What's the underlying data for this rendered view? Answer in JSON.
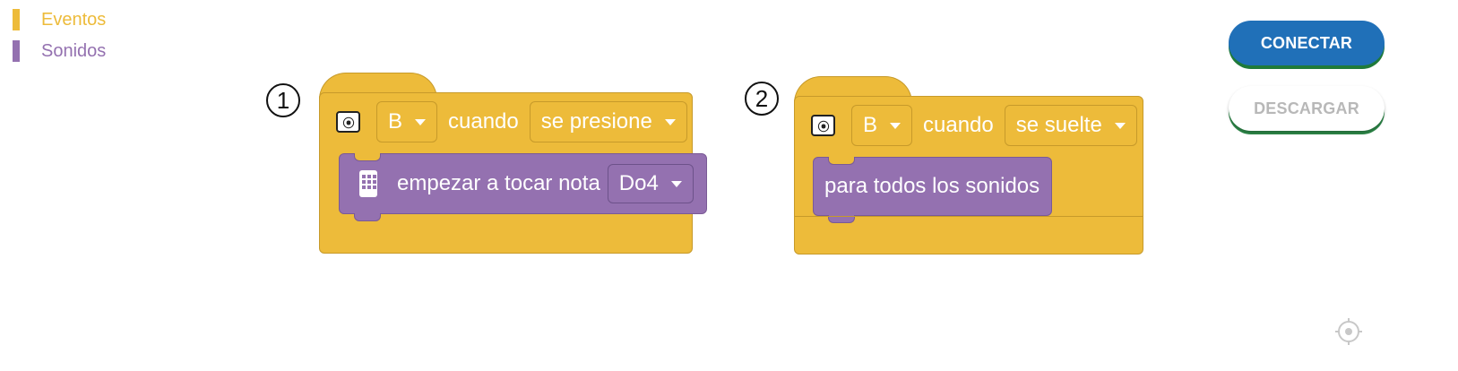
{
  "legend": {
    "items": [
      {
        "label": "Eventos",
        "color": "#edbb3a"
      },
      {
        "label": "Sonidos",
        "color": "#9471b0"
      }
    ]
  },
  "program1": {
    "number": "1",
    "device_icon": "microbit-device-icon",
    "button_value": "B",
    "cuando_label": "cuando",
    "event_value": "se presione",
    "sound_text": "empezar a tocar nota",
    "note_value": "Do4"
  },
  "program2": {
    "number": "2",
    "device_icon": "microbit-device-icon",
    "button_value": "B",
    "cuando_label": "cuando",
    "event_value": "se suelte",
    "sound_text": "para todos los sonidos"
  },
  "buttons": {
    "connect_label": "CONECTAR",
    "download_label": "DESCARGAR"
  },
  "colors": {
    "events": "#edbb3a",
    "sounds": "#9471b0",
    "connect": "#2070b8"
  },
  "recenter_icon": "target-icon"
}
